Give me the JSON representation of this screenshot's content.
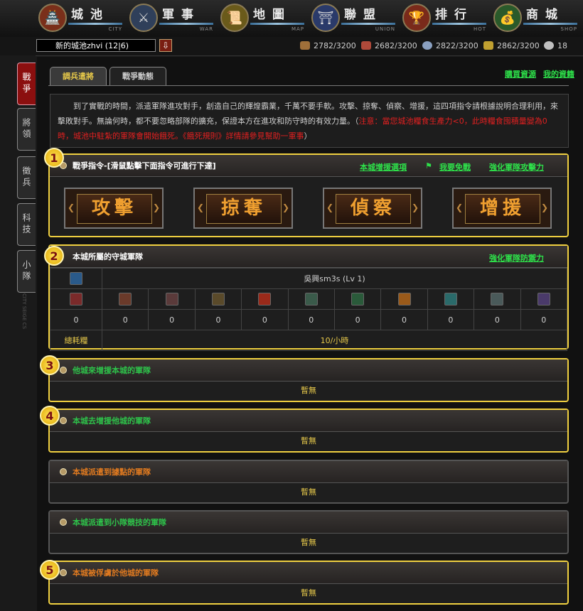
{
  "nav": [
    {
      "title": "城池",
      "sub": "CITY",
      "icon": "castle-icon",
      "glyph": "🏯",
      "color": "#7a2f1a"
    },
    {
      "title": "軍事",
      "sub": "WAR",
      "icon": "crossed-swords-icon",
      "glyph": "⚔",
      "color": "#2f3f5a"
    },
    {
      "title": "地圖",
      "sub": "MAP",
      "icon": "scroll-map-icon",
      "glyph": "📜",
      "color": "#6a5a1a"
    },
    {
      "title": "聯盟",
      "sub": "UNION",
      "icon": "alliance-icon",
      "glyph": "⛩",
      "color": "#2a3a6a"
    },
    {
      "title": "排行",
      "sub": "HOT",
      "icon": "ranking-banner-icon",
      "glyph": "🏆",
      "color": "#7a2a1a"
    },
    {
      "title": "商城",
      "sub": "SHOP",
      "icon": "treasure-chest-icon",
      "glyph": "💰",
      "color": "#2a5a2a"
    }
  ],
  "city": {
    "name": "新的城池zhvi (12|6)",
    "button": "⇩"
  },
  "resources": [
    {
      "icon": "wood-icon",
      "value": "2782/3200",
      "color": "#a0703a"
    },
    {
      "icon": "brick-icon",
      "value": "2682/3200",
      "color": "#b04a3a"
    },
    {
      "icon": "ore-icon",
      "value": "2822/3200",
      "color": "#8aa0c0"
    },
    {
      "icon": "grain-icon",
      "value": "2862/3200",
      "color": "#c0a030"
    },
    {
      "icon": "population-icon",
      "value": "18",
      "color": "#c0c0c0"
    }
  ],
  "side_tabs": [
    "戰爭",
    "將領",
    "徵兵",
    "科技",
    "小隊"
  ],
  "side_watermark": "CITY SEIGE CS",
  "tabs": {
    "active": "調兵遣將",
    "idle": "戰爭動態"
  },
  "top_links": [
    "購買資源",
    "我的資籍"
  ],
  "intro": {
    "text": "到了實戰的時間，派遣軍隊進攻對手，創造自己的輝煌霸業，千萬不要手軟。攻擊、掠奪、偵察、增援，這四項指令請根據說明合理利用，來擊敗對手。無論何時，都不要忽略部隊的擴充，保證本方在進攻和防守時的有效力量。（",
    "warning": "注意：當您城池糧食生產力<0，此時糧食囤積量變為0時，城池中駐紮的軍隊會開始餓死。《餓死規則》詳情請參見幫助一軍事",
    "tail": "）"
  },
  "command_panel": {
    "title": "戰爭指令-[滑鼠點擊下面指令可進行下達]",
    "links": [
      "本城增援選項",
      "我要免戰",
      "強化軍隊攻擊力"
    ],
    "buttons": [
      "攻擊",
      "掠奪",
      "偵察",
      "增援"
    ]
  },
  "garrison": {
    "title": "本城所屬的守城軍隊",
    "link": "強化軍隊防禦力",
    "general": "吳興sm3s (Lv 1)",
    "units": [
      {
        "icon": "spearman-icon",
        "count": "0",
        "color": "#7a2a2a"
      },
      {
        "icon": "swordsman-icon",
        "count": "0",
        "color": "#6a3a2a"
      },
      {
        "icon": "archer-icon",
        "count": "0",
        "color": "#5a3a3a"
      },
      {
        "icon": "axeman-icon",
        "count": "0",
        "color": "#5a4a2a"
      },
      {
        "icon": "cavalry-icon",
        "count": "0",
        "color": "#9a2a1a"
      },
      {
        "icon": "knight-icon",
        "count": "0",
        "color": "#3a5a4a"
      },
      {
        "icon": "scout-icon",
        "count": "0",
        "color": "#2a5a3a"
      },
      {
        "icon": "catapult-icon",
        "count": "0",
        "color": "#9a5a1a"
      },
      {
        "icon": "ballista-icon",
        "count": "0",
        "color": "#2a6a6a"
      },
      {
        "icon": "siege-tower-icon",
        "count": "0",
        "color": "#4a5a5a"
      },
      {
        "icon": "militia-icon",
        "count": "0",
        "color": "#4a3a6a"
      }
    ],
    "upkeep_label": "總耗糧",
    "upkeep_value": "10/小時"
  },
  "sections": [
    {
      "badge": "3",
      "title": "他城來增援本城的軍隊",
      "title_color": "#2ec24a",
      "empty": "暫無",
      "highlight": true
    },
    {
      "badge": "4",
      "title": "本城去增援他城的軍隊",
      "title_color": "#2ec24a",
      "empty": "暫無",
      "highlight": true
    },
    {
      "badge": "",
      "title": "本城派遣到據點的軍隊",
      "title_color": "#e07a20",
      "empty": "暫無",
      "highlight": false
    },
    {
      "badge": "",
      "title": "本城派遣到小隊競技的軍隊",
      "title_color": "#2ec24a",
      "empty": "暫無",
      "highlight": false
    },
    {
      "badge": "5",
      "title": "本城被俘虜於他城的軍隊",
      "title_color": "#e07a20",
      "empty": "暫無",
      "highlight": true
    }
  ],
  "badges": {
    "one": "1",
    "two": "2"
  }
}
